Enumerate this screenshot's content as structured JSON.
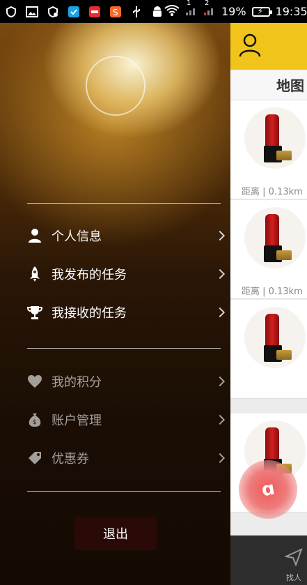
{
  "status_bar": {
    "battery": "19%",
    "time": "19:35",
    "signal_indicators": [
      "1",
      "2"
    ]
  },
  "drawer": {
    "menu_primary": [
      {
        "label": "个人信息",
        "icon": "person-icon"
      },
      {
        "label": "我发布的任务",
        "icon": "rocket-icon"
      },
      {
        "label": "我接收的任务",
        "icon": "trophy-icon"
      }
    ],
    "menu_secondary": [
      {
        "label": "我的积分",
        "icon": "heart-icon"
      },
      {
        "label": "账户管理",
        "icon": "money-bag-icon"
      },
      {
        "label": "优惠券",
        "icon": "tag-icon"
      }
    ],
    "logout_label": "退出"
  },
  "panel": {
    "header_icon": "person-outline-icon",
    "subheader": "地图",
    "cards": [
      {
        "distance": "距离 | 0.13km"
      },
      {
        "distance": "距离 | 0.13km"
      },
      {
        "distance": ""
      },
      {
        "distance": ""
      }
    ],
    "bottom_tab_label": "找人"
  },
  "colors": {
    "header_yellow": "#f0c41a",
    "fab_red": "#f05a5a",
    "logout_bg": "#2a0a06"
  }
}
